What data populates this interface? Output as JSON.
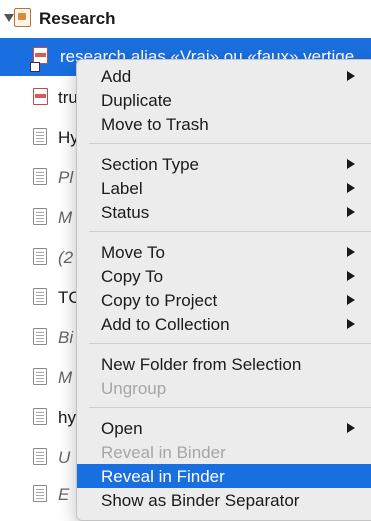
{
  "binder": {
    "folder_title": "Research",
    "selected_item": "research alias «Vrai» ou «faux» vertige",
    "rows": [
      {
        "text": "tru",
        "italic": false,
        "icon": "pdf-icon"
      },
      {
        "text": "Hy",
        "italic": false,
        "icon": "doc-icon"
      },
      {
        "text": "Pl",
        "italic": true,
        "icon": "doc-icon"
      },
      {
        "text": "M",
        "italic": true,
        "icon": "doc-icon"
      },
      {
        "text": "(2",
        "italic": true,
        "icon": "doc-icon"
      },
      {
        "text": "TC",
        "italic": false,
        "icon": "doc-icon"
      },
      {
        "text": "Bi",
        "italic": true,
        "icon": "doc-icon"
      },
      {
        "text": "M",
        "italic": true,
        "icon": "doc-icon"
      },
      {
        "text": "hy",
        "italic": false,
        "icon": "doc-icon"
      },
      {
        "text": "U",
        "italic": true,
        "icon": "doc-icon"
      },
      {
        "text": "E",
        "italic": true,
        "icon": "doc-icon"
      }
    ]
  },
  "menu": {
    "items": [
      {
        "label": "Add",
        "submenu": true,
        "disabled": false
      },
      {
        "label": "Duplicate",
        "submenu": false,
        "disabled": false
      },
      {
        "label": "Move to Trash",
        "submenu": false,
        "disabled": false
      },
      {
        "label": "Section Type",
        "submenu": true,
        "disabled": false
      },
      {
        "label": "Label",
        "submenu": true,
        "disabled": false
      },
      {
        "label": "Status",
        "submenu": true,
        "disabled": false
      },
      {
        "label": "Move To",
        "submenu": true,
        "disabled": false
      },
      {
        "label": "Copy To",
        "submenu": true,
        "disabled": false
      },
      {
        "label": "Copy to Project",
        "submenu": true,
        "disabled": false
      },
      {
        "label": "Add to Collection",
        "submenu": true,
        "disabled": false
      },
      {
        "label": "New Folder from Selection",
        "submenu": false,
        "disabled": false
      },
      {
        "label": "Ungroup",
        "submenu": false,
        "disabled": true
      },
      {
        "label": "Open",
        "submenu": true,
        "disabled": false
      },
      {
        "label": "Reveal in Binder",
        "submenu": false,
        "disabled": true
      },
      {
        "label": "Reveal in Finder",
        "submenu": false,
        "disabled": false,
        "highlighted": true
      },
      {
        "label": "Show as Binder Separator",
        "submenu": false,
        "disabled": false
      }
    ]
  }
}
